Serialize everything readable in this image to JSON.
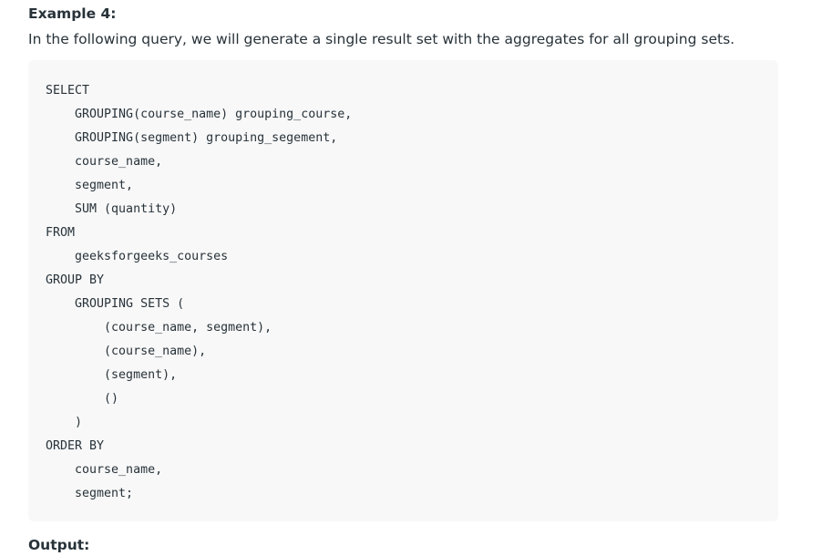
{
  "article": {
    "heading": "Example 4:",
    "intro": "In the following query, we will generate a single result set with the aggregates for all grouping sets.",
    "output_label": "Output:"
  },
  "code": {
    "lines": [
      "SELECT",
      "    GROUPING(course_name) grouping_course,",
      "    GROUPING(segment) grouping_segement,",
      "    course_name,",
      "    segment,",
      "    SUM (quantity)",
      "FROM",
      "    geeksforgeeks_courses",
      "GROUP BY",
      "    GROUPING SETS (",
      "        (course_name, segment),",
      "        (course_name),",
      "        (segment),",
      "        ()",
      "    )",
      "ORDER BY",
      "    course_name,",
      "    segment;"
    ]
  }
}
